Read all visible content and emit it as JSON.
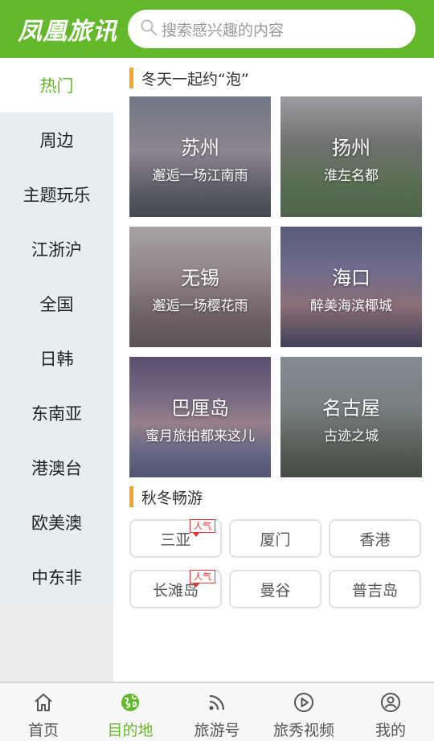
{
  "header": {
    "logo": "凤凰旅讯",
    "search_placeholder": "搜索感兴趣的内容",
    "brand_color": "#64b82b"
  },
  "sidebar": {
    "items": [
      {
        "label": "热门",
        "active": true
      },
      {
        "label": "周边"
      },
      {
        "label": "主题玩乐"
      },
      {
        "label": "江浙沪"
      },
      {
        "label": "全国"
      },
      {
        "label": "日韩"
      },
      {
        "label": "东南亚"
      },
      {
        "label": "港澳台"
      },
      {
        "label": "欧美澳"
      },
      {
        "label": "中东非"
      }
    ]
  },
  "sections": {
    "winter": {
      "title": "冬天一起约“泡”",
      "cards": [
        {
          "name": "苏州",
          "sub": "邂逅一场江南雨"
        },
        {
          "name": "扬州",
          "sub": "淮左名都"
        },
        {
          "name": "无锡",
          "sub": "邂逅一场樱花雨"
        },
        {
          "name": "海口",
          "sub": "醉美海滨椰城"
        },
        {
          "name": "巴厘岛",
          "sub": "蜜月旅拍都来这儿"
        },
        {
          "name": "名古屋",
          "sub": "古迹之城"
        }
      ]
    },
    "autumn": {
      "title": "秋冬畅游",
      "tags": [
        {
          "label": "三亚",
          "badge": "人气"
        },
        {
          "label": "厦门"
        },
        {
          "label": "香港"
        },
        {
          "label": "长滩岛",
          "badge": "人气"
        },
        {
          "label": "曼谷"
        },
        {
          "label": "普吉岛"
        }
      ]
    }
  },
  "tabbar": {
    "items": [
      {
        "label": "首页",
        "icon": "home-icon"
      },
      {
        "label": "目的地",
        "icon": "globe-icon",
        "active": true
      },
      {
        "label": "旅游号",
        "icon": "rss-icon"
      },
      {
        "label": "旅秀视频",
        "icon": "play-icon"
      },
      {
        "label": "我的",
        "icon": "user-icon"
      }
    ]
  }
}
